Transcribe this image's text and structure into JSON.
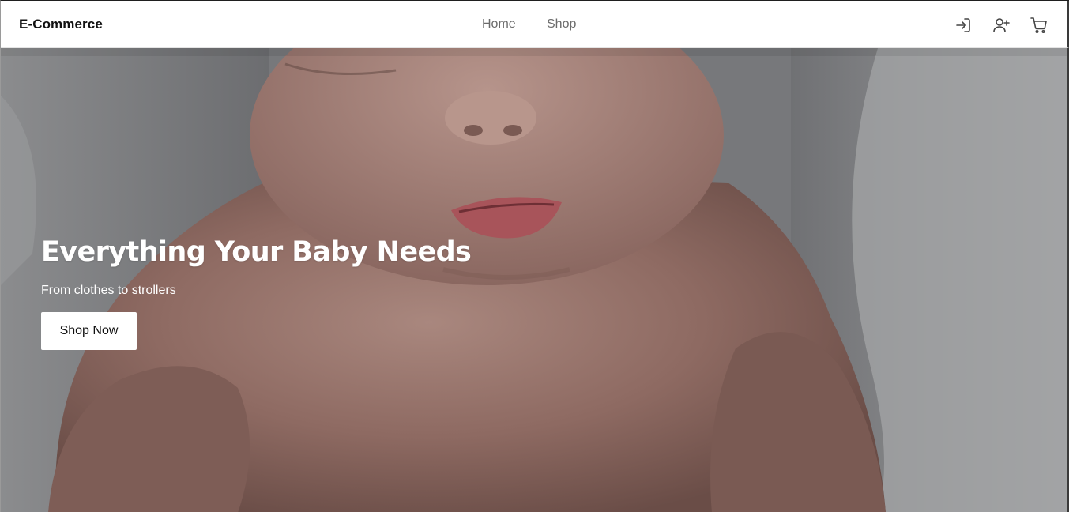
{
  "navbar": {
    "brand": "E-Commerce",
    "links": [
      {
        "label": "Home"
      },
      {
        "label": "Shop"
      }
    ],
    "icons": [
      "login-icon",
      "user-plus-icon",
      "cart-icon"
    ],
    "icon_color": "#444444"
  },
  "hero": {
    "title": "Everything Your Baby Needs",
    "subtitle": "From clothes to strollers",
    "button_label": "Shop Now",
    "image": "sleeping-baby-photo",
    "overlay_color": "#000000"
  }
}
